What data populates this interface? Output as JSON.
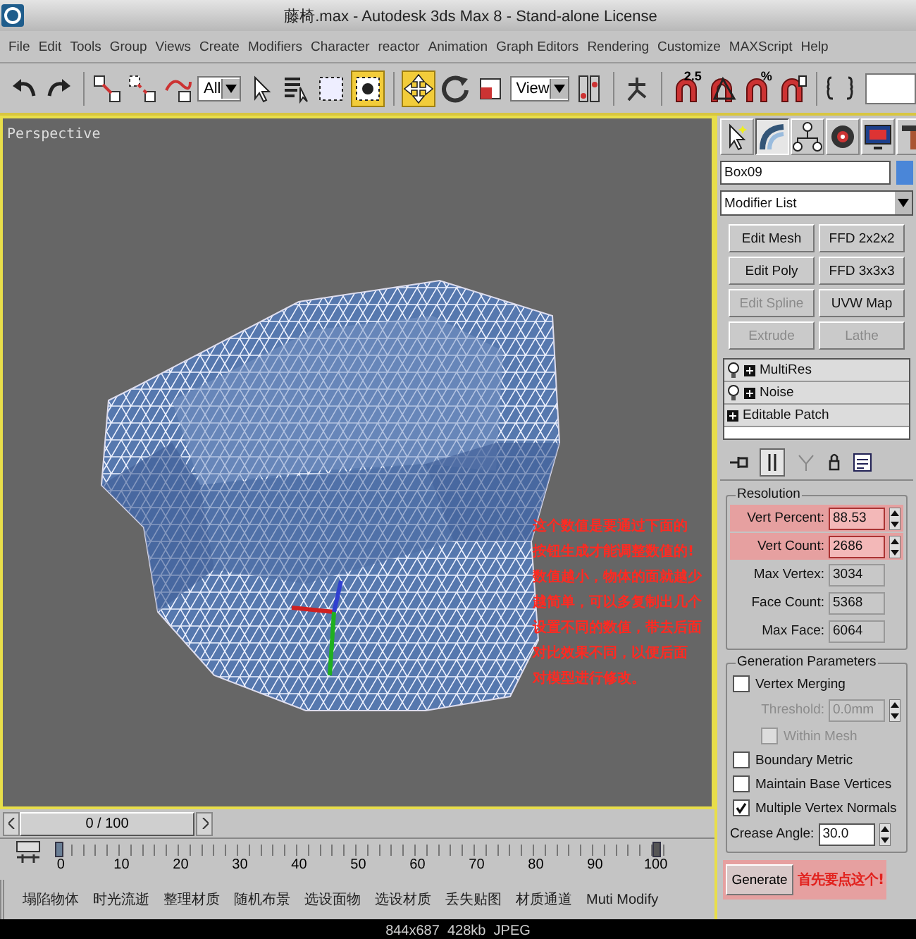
{
  "window": {
    "title": "藤椅.max - Autodesk 3ds Max 8  - Stand-alone License"
  },
  "menu": [
    "File",
    "Edit",
    "Tools",
    "Group",
    "Views",
    "Create",
    "Modifiers",
    "Character",
    "reactor",
    "Animation",
    "Graph Editors",
    "Rendering",
    "Customize",
    "MAXScript",
    "Help"
  ],
  "toolbar": {
    "selection_filter": "All",
    "reference_coord": "View",
    "angle_snap_label": "2.5",
    "percent_snap_label": "%",
    "window_crossing_on": true,
    "move_on": true
  },
  "viewport": {
    "label": "Perspective",
    "note_lines": [
      "这个数值是要通过下面的",
      "按钮生成才能调整数值的!",
      "数值越小，物体的面就越少",
      "越简单，可以多复制出几个",
      "设置不同的数值，带去后面",
      "对比效果不同，以便后面",
      "对模型进行修改。"
    ]
  },
  "command_panel": {
    "tabs": [
      {
        "kind": "create",
        "selected": false
      },
      {
        "kind": "modify",
        "selected": true
      },
      {
        "kind": "hierarchy",
        "selected": false
      },
      {
        "kind": "motion",
        "selected": false
      },
      {
        "kind": "display",
        "selected": false
      },
      {
        "kind": "utilities",
        "selected": false
      }
    ],
    "object_name": "Box09",
    "modifier_list": "Modifier List",
    "modifier_buttons": [
      {
        "label": "Edit Mesh",
        "disabled": false
      },
      {
        "label": "FFD 2x2x2",
        "disabled": false
      },
      {
        "label": "Edit Poly",
        "disabled": false
      },
      {
        "label": "FFD 3x3x3",
        "disabled": false
      },
      {
        "label": "Edit Spline",
        "disabled": true
      },
      {
        "label": "UVW Map",
        "disabled": false
      },
      {
        "label": "Extrude",
        "disabled": true
      },
      {
        "label": "Lathe",
        "disabled": true
      }
    ],
    "stack": [
      {
        "label": "MultiRes",
        "kind": "modifier"
      },
      {
        "label": "Noise",
        "kind": "modifier"
      },
      {
        "label": "Editable Patch",
        "kind": "base"
      }
    ],
    "resolution": {
      "title": "Resolution",
      "fields": [
        {
          "label": "Vert Percent:",
          "value": "88.53",
          "kind": "spinner",
          "highlighted": true
        },
        {
          "label": "Vert Count:",
          "value": "2686",
          "kind": "spinner",
          "highlighted": true
        },
        {
          "label": "Max Vertex:",
          "value": "3034",
          "kind": "readout",
          "highlighted": false
        },
        {
          "label": "Face Count:",
          "value": "5368",
          "kind": "readout",
          "highlighted": false
        },
        {
          "label": "Max Face:",
          "value": "6064",
          "kind": "readout",
          "highlighted": false
        }
      ]
    },
    "generation": {
      "title": "Generation Parameters",
      "options": [
        {
          "kind": "checkbox",
          "label": "Vertex Merging",
          "checked": false,
          "disabled": false
        },
        {
          "kind": "spinner",
          "label": "Threshold:",
          "value": "0.0mm",
          "disabled": true
        },
        {
          "kind": "checkbox",
          "label": "Within Mesh",
          "checked": false,
          "disabled": true
        },
        {
          "kind": "checkbox",
          "label": "Boundary Metric",
          "checked": false,
          "disabled": false
        },
        {
          "kind": "checkbox",
          "label": "Maintain Base Vertices",
          "checked": false,
          "disabled": false
        },
        {
          "kind": "checkbox",
          "label": "Multiple Vertex Normals",
          "checked": true,
          "disabled": false
        },
        {
          "kind": "spinner",
          "label": "Crease Angle:",
          "value": "30.0",
          "disabled": false
        }
      ]
    },
    "generate_button": {
      "label": "Generate",
      "highlighted": true
    },
    "generate_note": "首先要点这个!"
  },
  "timeline": {
    "frame_label": "0 / 100",
    "level": 0,
    "ticks": [
      "0",
      "10",
      "20",
      "30",
      "40",
      "50",
      "60",
      "70",
      "80",
      "90",
      "100"
    ]
  },
  "quick_buttons": [
    "塌陷物体",
    "时光流逝",
    "整理材质",
    "随机布景",
    "选设面物",
    "选设材质",
    "丢失贴图",
    "材质通道",
    "Muti Modify"
  ],
  "status_bar": "844x687  428kb  JPEG"
}
